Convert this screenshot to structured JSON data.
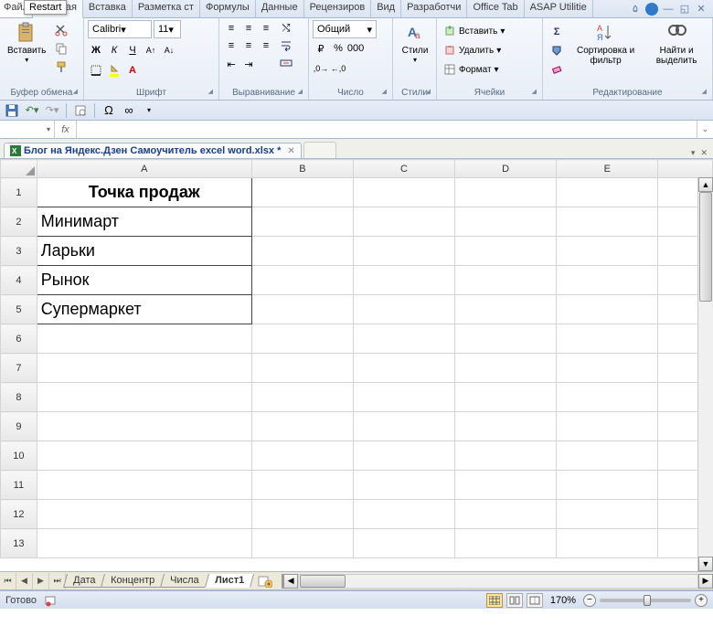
{
  "tooltip": "Restart",
  "ribbon": {
    "tabs": [
      "Файл",
      "Главная",
      "Вставка",
      "Разметка ст",
      "Формулы",
      "Данные",
      "Рецензиров",
      "Вид",
      "Разработчи",
      "Office Tab",
      "ASAP Utilitie"
    ],
    "active_tab_index": 1
  },
  "clipboard": {
    "label": "Буфер обмена",
    "paste": "Вставить"
  },
  "font": {
    "label": "Шрифт",
    "name": "Calibri",
    "size": "11"
  },
  "alignment": {
    "label": "Выравнивание"
  },
  "number": {
    "label": "Число",
    "format": "Общий"
  },
  "styles": {
    "label": "Стили",
    "btn": "Стили"
  },
  "cells": {
    "label": "Ячейки",
    "insert": "Вставить",
    "delete": "Удалить",
    "format": "Формат"
  },
  "editing": {
    "label": "Редактирование",
    "sort": "Сортировка и фильтр",
    "find": "Найти и выделить"
  },
  "namebox": "",
  "fx": "fx",
  "formula": "",
  "doc_tab": {
    "name": "Блог на Яндекс.Дзен Самоучитель excel word.xlsx *"
  },
  "columns": [
    "A",
    "B",
    "C",
    "D",
    "E"
  ],
  "row_headers": [
    "1",
    "2",
    "3",
    "4",
    "5",
    "6",
    "7",
    "8",
    "9",
    "10",
    "11",
    "12",
    "13"
  ],
  "cells_data": {
    "A1": "Точка продаж",
    "A2": "Минимарт",
    "A3": "Ларьки",
    "A4": "Рынок",
    "A5": "Супермаркет"
  },
  "sheet_tabs": [
    "Дата",
    "Концентр",
    "Числа",
    "Лист1"
  ],
  "active_sheet_index": 3,
  "status": {
    "ready": "Готово"
  },
  "zoom": "170%"
}
